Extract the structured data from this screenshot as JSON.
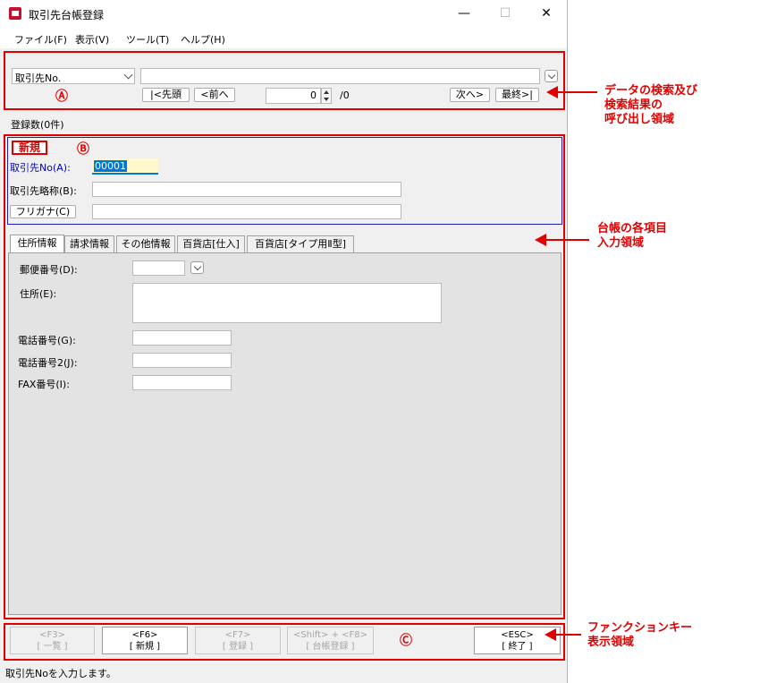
{
  "window": {
    "title": "取引先台帳登録",
    "minimize": "—",
    "maximize": "☐",
    "close": "✕"
  },
  "menu": [
    "ファイル(F)",
    "表示(V)",
    "ツール(T)",
    "ヘルプ(H)"
  ],
  "search": {
    "field_select": "取引先No.",
    "first": "|<先頭",
    "prev": "<前へ",
    "page_value": "0",
    "page_total": "/0",
    "next": "次へ>",
    "last": "最終>|",
    "marker": "Ⓐ"
  },
  "record_count": "登録数(0件)",
  "header": {
    "mode_badge": "新規",
    "marker": "Ⓑ",
    "code_label": "取引先No(A):",
    "code_value": "00001",
    "short_name_label": "取引先略称(B):",
    "furigana_button": "フリガナ(C)"
  },
  "tabs": [
    "住所情報",
    "請求情報",
    "その他情報",
    "百貨店[仕入]",
    "百貨店[タイプ用Ⅱ型]"
  ],
  "address": {
    "postal_label": "郵便番号(D):",
    "address_label": "住所(E):",
    "phone_label": "電話番号(G):",
    "phone2_label": "電話番号2(J):",
    "fax_label": "FAX番号(I):"
  },
  "fkeys": [
    {
      "key": "<F3>",
      "label": "[ 一覧 ]",
      "enabled": false
    },
    {
      "key": "<F6>",
      "label": "[ 新規 ]",
      "enabled": true
    },
    {
      "key": "<F7>",
      "label": "[ 登録 ]",
      "enabled": false
    },
    {
      "key": "<Shift> + <F8>",
      "label": "[ 台帳登録 ]",
      "enabled": false
    },
    {
      "key": "<ESC>",
      "label": "[ 終了 ]",
      "enabled": true
    }
  ],
  "fkey_marker": "Ⓒ",
  "status": "取引先Noを入力します。",
  "annotations": {
    "a": [
      "データの検索及び",
      "検索結果の",
      "呼び出し領域"
    ],
    "b": [
      "台帳の各項目",
      "入力領域"
    ],
    "c": [
      "ファンクションキー",
      "表示領域"
    ]
  },
  "colors": {
    "annotation_red": "#e00000",
    "header_border": "#1e1eb4",
    "field_label_blue": "#0000c8",
    "selected_bg": "#0078d7"
  }
}
